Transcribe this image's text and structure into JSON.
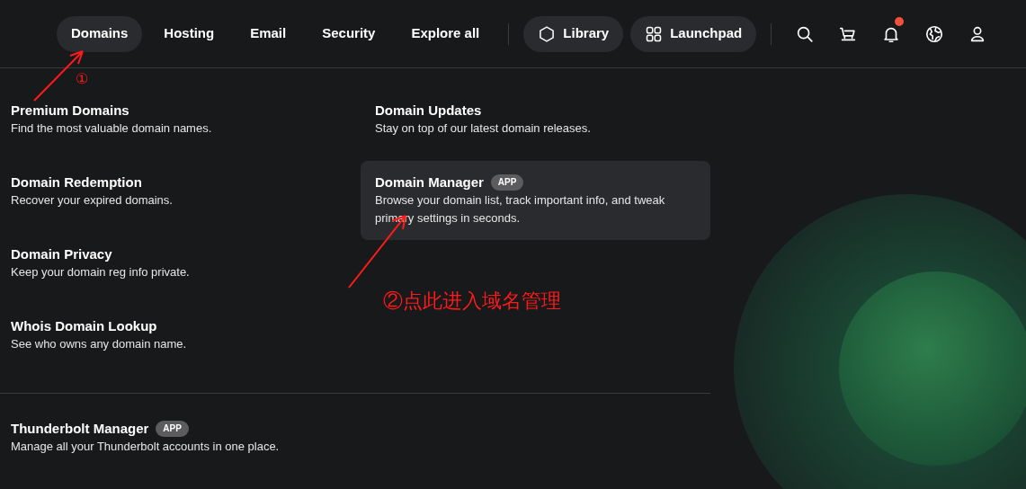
{
  "nav": {
    "items": [
      {
        "label": "Domains",
        "selected": true
      },
      {
        "label": "Hosting",
        "selected": false
      },
      {
        "label": "Email",
        "selected": false
      },
      {
        "label": "Security",
        "selected": false
      },
      {
        "label": "Explore all",
        "selected": false
      }
    ],
    "pills": [
      {
        "label": "Library",
        "kind": "hexagon"
      },
      {
        "label": "Launchpad",
        "kind": "grid"
      }
    ],
    "icons": [
      {
        "kind": "search",
        "dot": false
      },
      {
        "kind": "cart",
        "dot": false
      },
      {
        "kind": "bell",
        "dot": true
      },
      {
        "kind": "globe",
        "dot": false
      },
      {
        "kind": "user",
        "dot": false
      }
    ]
  },
  "menu": {
    "left": [
      {
        "title": "Premium Domains",
        "description": "Find the most valuable domain names."
      },
      {
        "title": "Domain Redemption",
        "description": "Recover your expired domains."
      },
      {
        "title": "Domain Privacy",
        "description": "Keep your domain reg info private."
      },
      {
        "title": "Whois Domain Lookup",
        "description": "See who owns any domain name."
      }
    ],
    "right": [
      {
        "title": "Domain Updates",
        "description": "Stay on top of our latest domain releases.",
        "highlighted": false
      },
      {
        "title": "Domain Manager",
        "badge": "APP",
        "description": "Browse your domain list, track important info, and tweak primary settings in seconds.",
        "highlighted": true
      }
    ],
    "footer": {
      "title": "Thunderbolt Manager",
      "badge": "APP",
      "description": "Manage all your Thunderbolt accounts in one place."
    }
  },
  "annotations": [
    {
      "text": "①"
    },
    {
      "text": "②点此进入域名管理"
    }
  ]
}
